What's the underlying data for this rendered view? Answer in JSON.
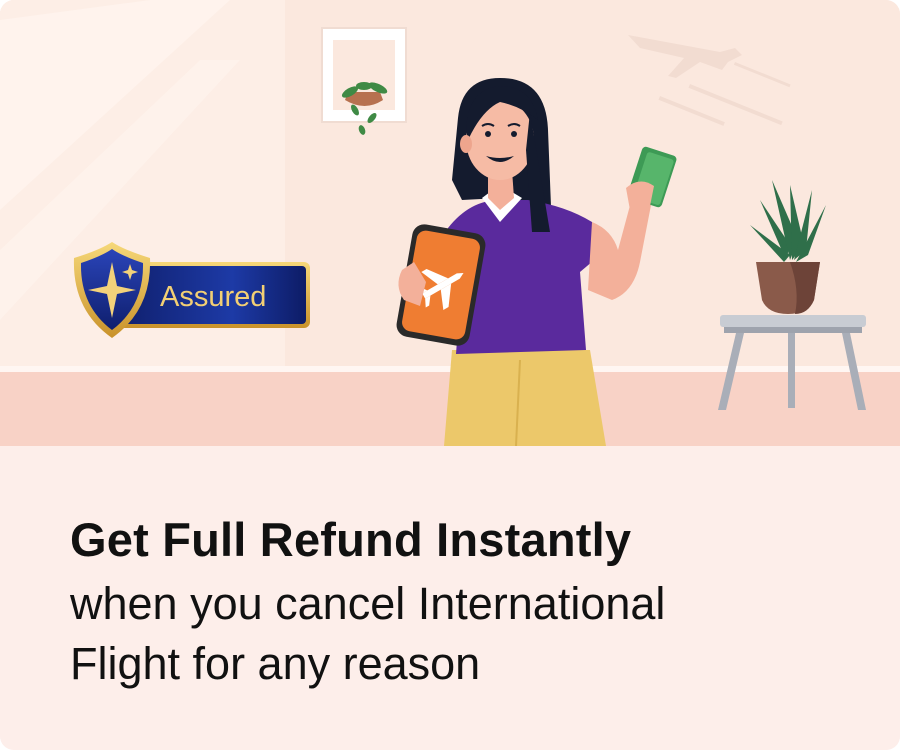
{
  "badge": {
    "label": "Assured",
    "icon": "shield-star-icon"
  },
  "headline": "Get Full Refund Instantly",
  "subline_lines": [
    "when you cancel International",
    "Flight for any reason"
  ],
  "phone_icon": "airplane-icon",
  "colors": {
    "background": "#fdeeea",
    "wall": "#fbe9df",
    "floor": "#f7d3c8",
    "badge_blue": "#1b2a8a",
    "badge_gold": "#e7b93d",
    "shirt_purple": "#5b2a9e",
    "skirt_yellow": "#ecc96a",
    "phone_orange": "#ef7d32",
    "text": "#111111"
  }
}
